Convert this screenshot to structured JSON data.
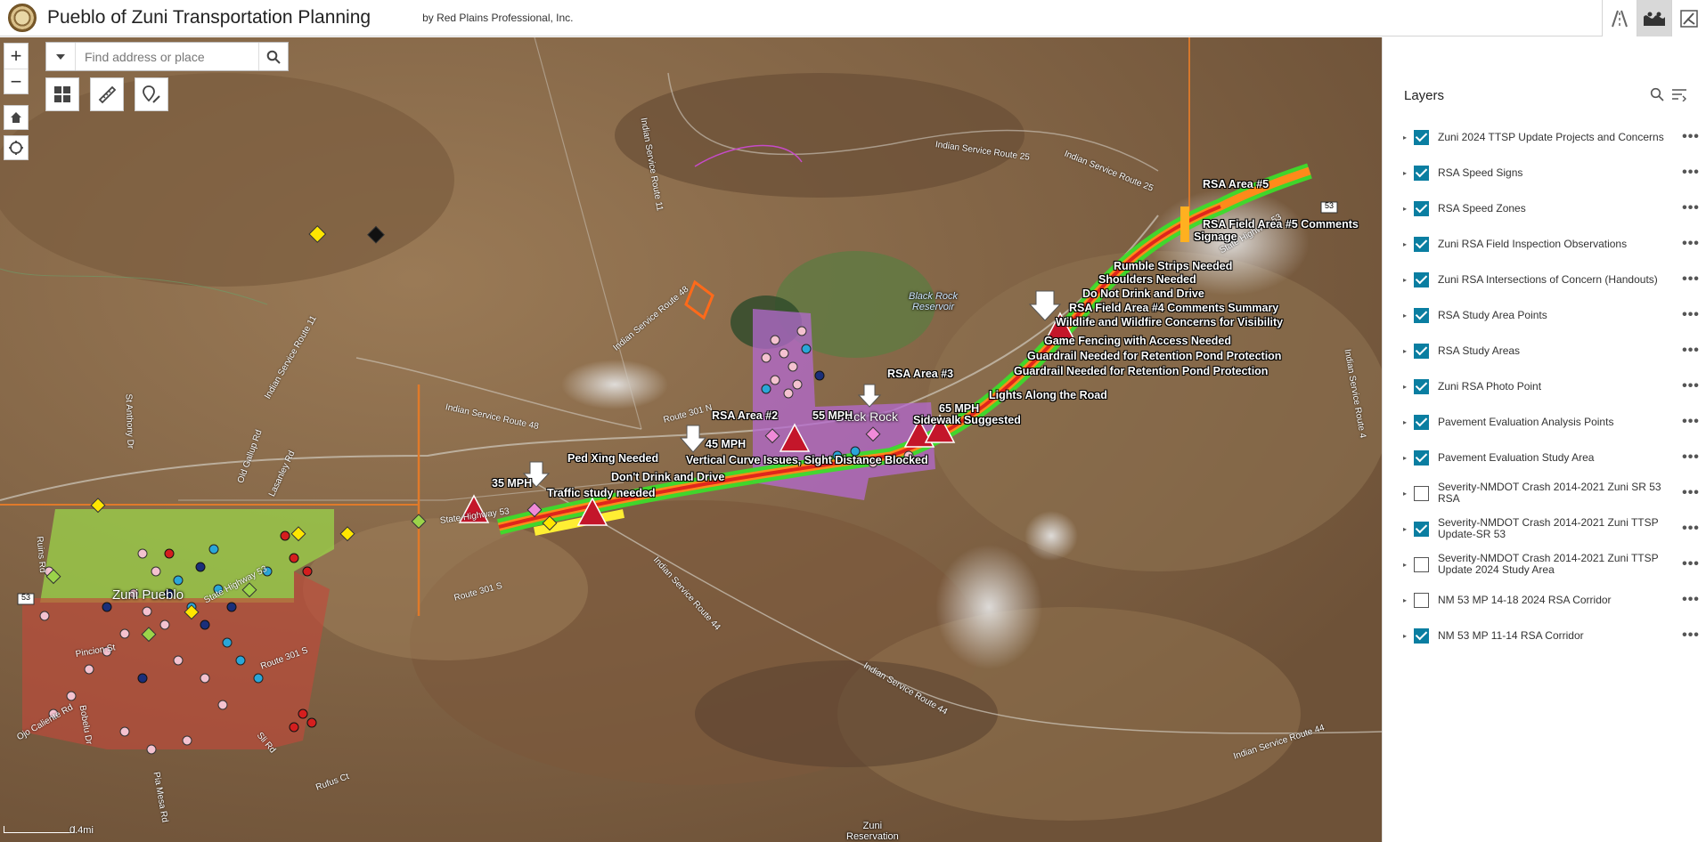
{
  "header": {
    "title": "Pueblo of Zuni Transportation Planning",
    "subtitle": "by Red Plains Professional, Inc.",
    "tools": [
      "road-icon",
      "basemap-icon",
      "logo-icon"
    ]
  },
  "map": {
    "search": {
      "placeholder": "Find address or place"
    },
    "zoom_in": "+",
    "zoom_out": "−",
    "scale_label": "0.4mi",
    "place_labels": {
      "zuni_pueblo": "Zuni Pueblo",
      "black_rock": "Black Rock",
      "black_rock_reservoir": "Black Rock\nReservoir",
      "zuni_reservation": "Zuni\nReservation"
    },
    "road_labels": {
      "isr25": "Indian Service Route 25",
      "isr25b": "Indian Service Route 25",
      "isr11": "Indian Service Route 11",
      "isr11b": "Indian Service Route 11",
      "isr48": "Indian Service Route 48",
      "isr48b": "Indian Service Route 48",
      "isr44": "Indian Service Route 44",
      "isr44b": "Indian Service Route 44",
      "isr44c": "Indian Service Route 44",
      "route301n": "Route 301 N",
      "route301s": "Route 301 S",
      "route301s2": "Route 301 S",
      "sh53": "State Highway 53",
      "sh53b": "State Highway 53",
      "sh53c": "State Highway 53",
      "rsa_gap": "Indian Service Route 4",
      "st_anthony": "St Anthony Dr",
      "old_gallup": "Old Gallup Rd",
      "lasanley": "Lasanley Rd",
      "ruins": "Ruins Rd",
      "pincion": "Pincion St",
      "ojo_caliente": "Ojo Caliente Rd",
      "bobelu": "Bobelu Dr",
      "pia_mesa": "Pia Mesa Rd",
      "rufus": "Rufus Ct",
      "sli": "Sli Rd",
      "hwy53_shield": "53",
      "hwy53_shield_b": "53"
    },
    "annotations": {
      "rsa5": "RSA Area #5",
      "rsa5_comments": "RSA Field Area #5 Comments",
      "signage": "Signage",
      "rumble": "Rumble Strips Needed",
      "shoulders": "Shoulders Needed",
      "do_not_drink": "Do Not Drink and Drive",
      "rsa4_summary": "RSA Field Area #4 Comments Summary",
      "wildlife": "Wildlife and Wildfire Concerns for Visibility",
      "game_fencing": "Game Fencing with Access Needed",
      "guardrail1": "Guardrail Needed for Retention Pond Protection",
      "guardrail2": "Guardrail Needed for Retention Pond Protection",
      "lights": "Lights Along the Road",
      "rsa3": "RSA Area #3",
      "mph65": "65 MPH",
      "sidewalk": "Sidewalk Suggested",
      "mph55": "55 MPH",
      "rsa2": "RSA Area #2",
      "mph45": "45 MPH",
      "ped_xing": "Ped Xing Needed",
      "vertical_curve": "Vertical Curve Issues, Sight Distance Blocked",
      "dont_drink": "Don't Drink and Drive",
      "mph35": "35 MPH",
      "traffic_study": "Traffic study needed"
    }
  },
  "layers": {
    "title": "Layers",
    "items": [
      {
        "label": "Zuni 2024 TTSP Update Projects and Concerns",
        "checked": true
      },
      {
        "label": "RSA Speed Signs",
        "checked": true
      },
      {
        "label": "RSA Speed Zones",
        "checked": true
      },
      {
        "label": "Zuni RSA Field Inspection Observations",
        "checked": true
      },
      {
        "label": "Zuni RSA Intersections of Concern (Handouts)",
        "checked": true
      },
      {
        "label": "RSA Study Area Points",
        "checked": true
      },
      {
        "label": "RSA Study Areas",
        "checked": true
      },
      {
        "label": "Zuni RSA Photo Point",
        "checked": true
      },
      {
        "label": "Pavement Evaluation Analysis Points",
        "checked": true
      },
      {
        "label": "Pavement Evaluation Study Area",
        "checked": true
      },
      {
        "label": "Severity-NMDOT Crash 2014-2021 Zuni SR 53 RSA",
        "checked": false
      },
      {
        "label": "Severity-NMDOT Crash 2014-2021 Zuni TTSP Update-SR 53",
        "checked": true
      },
      {
        "label": "Severity-NMDOT Crash 2014-2021 Zuni TTSP Update 2024 Study Area",
        "checked": false
      },
      {
        "label": "NM 53 MP 14-18 2024 RSA Corridor",
        "checked": false
      },
      {
        "label": "NM 53 MP 11-14 RSA Corridor",
        "checked": true
      }
    ]
  },
  "colors": {
    "accent": "#0a7ea1",
    "terrain": "#8a6a48",
    "corridor_green": "#3ddc2a",
    "corridor_orange": "#ff8a1a",
    "corridor_red": "#e0261c",
    "study_area_purple": "#b46ad0",
    "study_area_green": "#9bd44a",
    "study_area_red": "#c04a3a"
  }
}
